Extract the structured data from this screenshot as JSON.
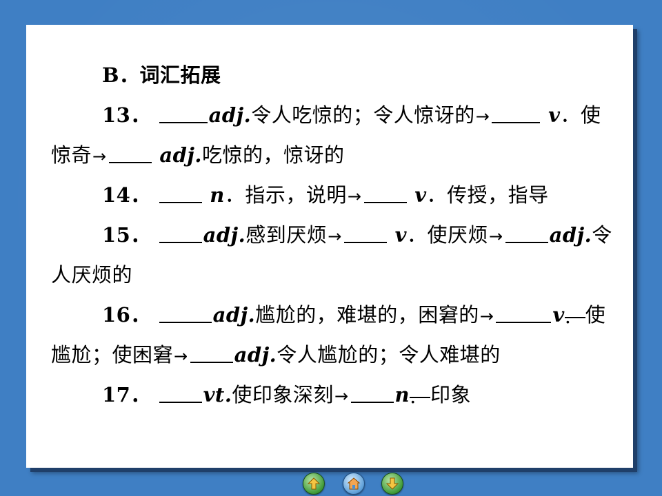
{
  "section": {
    "heading": "B．词汇拓展"
  },
  "items": {
    "i13": {
      "num": "13．",
      "pos1": "adj.",
      "text1": "令人吃惊的；令人惊讶的",
      "pos2": "v",
      "text2": "．使",
      "text3": "惊奇",
      "pos3": "adj.",
      "text4": "吃惊的，惊讶的"
    },
    "i14": {
      "num": "14．",
      "pos1": "n",
      "text1": "．指示，说明",
      "pos2": "v",
      "text2": "．传授，指导"
    },
    "i15": {
      "num": "15．",
      "pos1": "adj.",
      "text1": "感到厌烦",
      "pos2": "v",
      "text2": "．使厌烦",
      "pos3": "adj.",
      "text3": "令",
      "text4": "人厌烦的"
    },
    "i16": {
      "num": "16．",
      "pos1": "adj.",
      "text1": "尴尬的，难堪的，困窘的",
      "pos2": "v",
      "text2": ".",
      "text3": "使",
      "text4": "尴尬；使困窘",
      "pos3": "adj.",
      "text5": "令人尴尬的；令人难堪的"
    },
    "i17": {
      "num": "17．",
      "pos1": "vt.",
      "text1": "使印象深刻",
      "pos2": "n",
      "text2": ".",
      "text3": "印象"
    }
  },
  "symbols": {
    "arrow": "→"
  },
  "nav": {
    "prev_icon": "arrow-left-icon",
    "home_icon": "home-icon",
    "next_icon": "arrow-right-icon"
  },
  "colors": {
    "background": "#3f7fc4",
    "panel": "#ffffff",
    "nav_green": "#3f9a37"
  }
}
